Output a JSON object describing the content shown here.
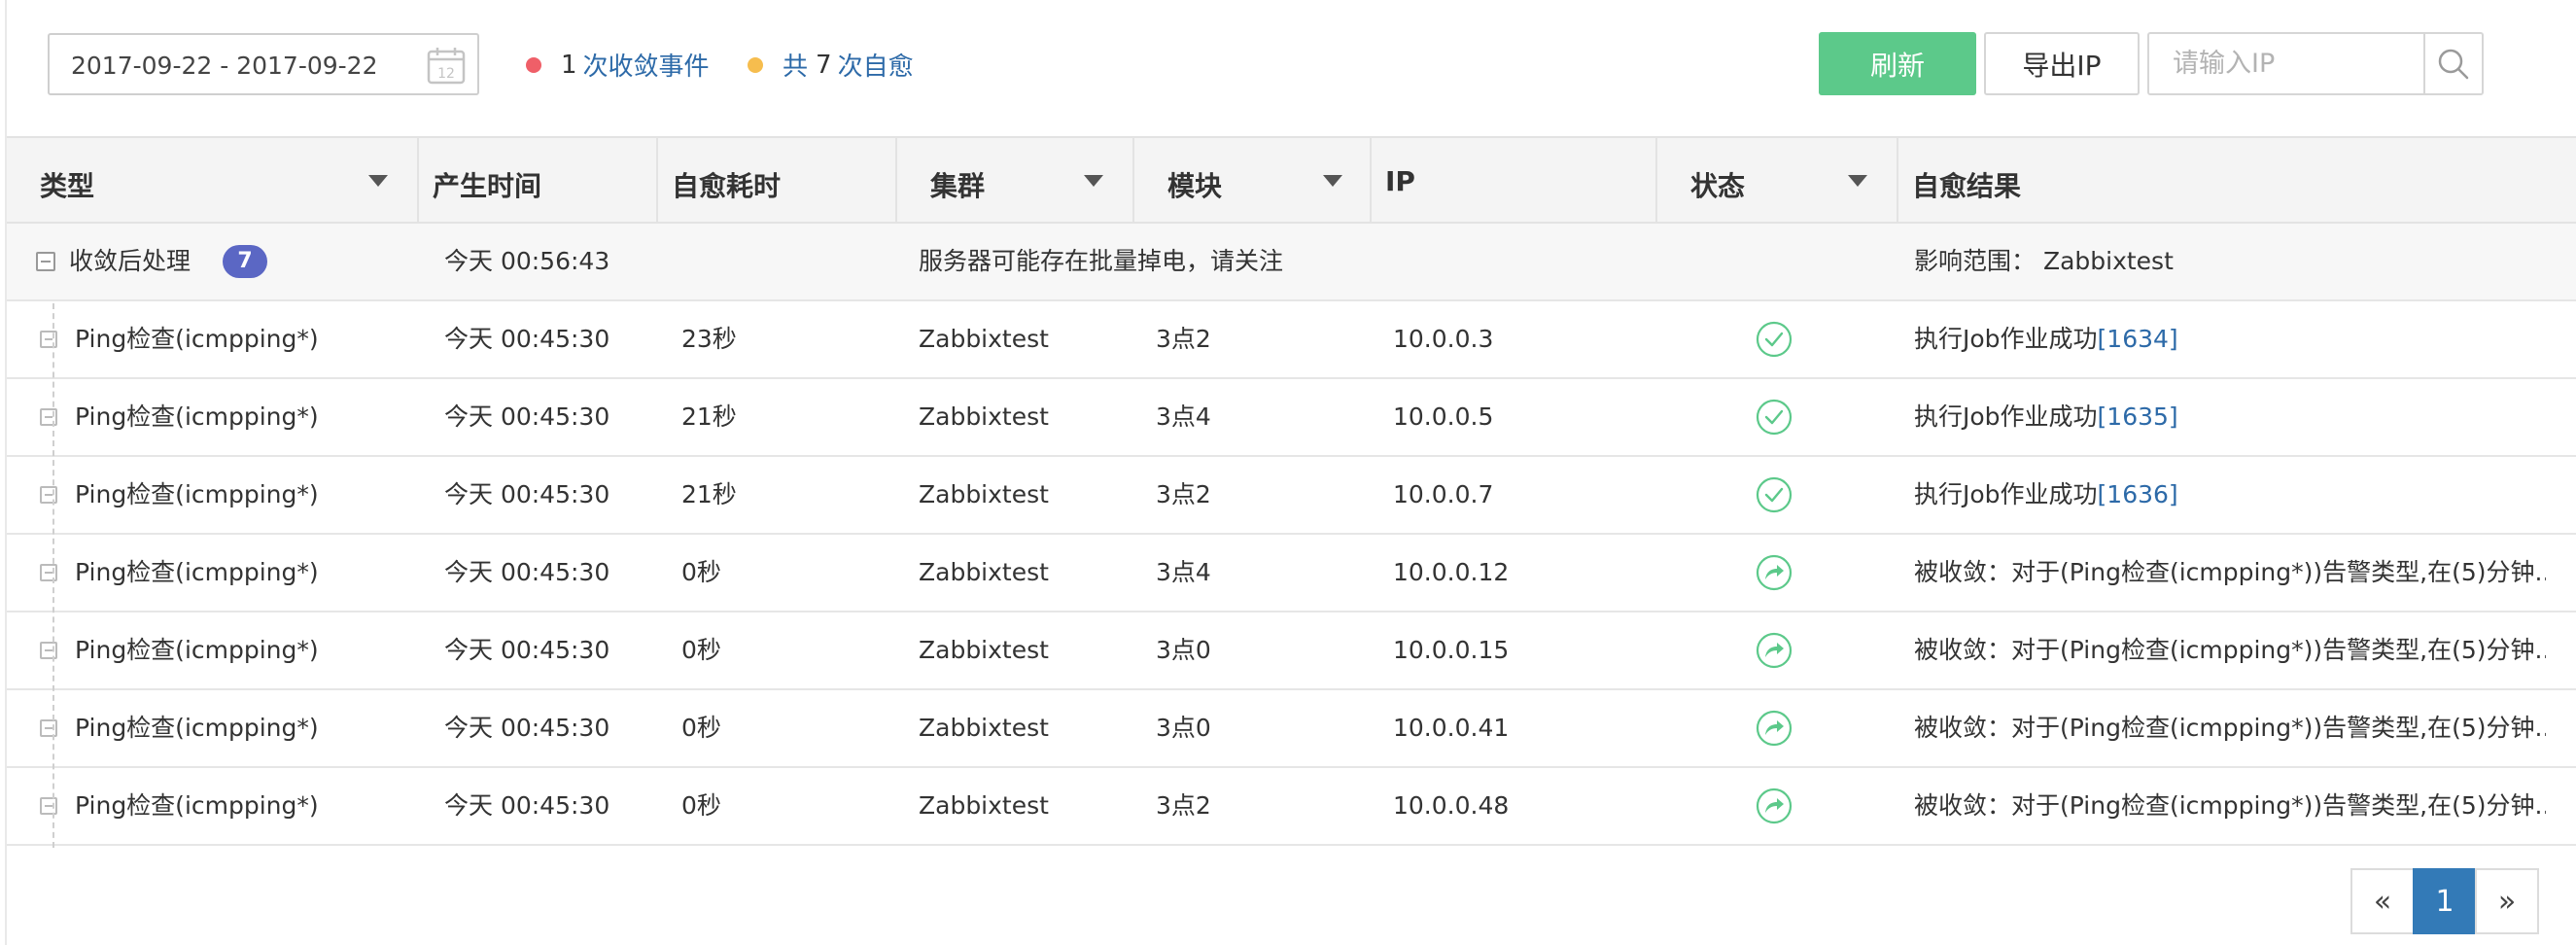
{
  "toolbar": {
    "date_range": "2017-09-22 - 2017-09-22",
    "calendar_day": "12",
    "converge_count": "1",
    "converge_label": "次收敛事件",
    "heal_prefix": "共",
    "heal_count": "7",
    "heal_label": "次自愈",
    "converge_dot_color": "#ef5f68",
    "heal_dot_color": "#f6bd4e",
    "refresh_label": "刷新",
    "export_label": "导出IP",
    "search_placeholder": "请输入IP",
    "search_icon": "search-icon"
  },
  "table": {
    "columns": [
      "类型",
      "产生时间",
      "自愈耗时",
      "集群",
      "模块",
      "IP",
      "状态",
      "自愈结果"
    ],
    "group": {
      "type": "收敛后处理",
      "count": "7",
      "time": "今天 00:56:43",
      "message": "服务器可能存在批量掉电，请关注",
      "scope": "影响范围： Zabbixtest"
    },
    "rows": [
      {
        "type": "Ping检查(icmpping*)",
        "time": "今天 00:45:30",
        "duration": "23秒",
        "cluster": "Zabbixtest",
        "module": "3点2",
        "ip": "10.0.0.3",
        "status": "success",
        "result": "执行Job作业成功",
        "job": "[1634]"
      },
      {
        "type": "Ping检查(icmpping*)",
        "time": "今天 00:45:30",
        "duration": "21秒",
        "cluster": "Zabbixtest",
        "module": "3点4",
        "ip": "10.0.0.5",
        "status": "success",
        "result": "执行Job作业成功",
        "job": "[1635]"
      },
      {
        "type": "Ping检查(icmpping*)",
        "time": "今天 00:45:30",
        "duration": "21秒",
        "cluster": "Zabbixtest",
        "module": "3点2",
        "ip": "10.0.0.7",
        "status": "success",
        "result": "执行Job作业成功",
        "job": "[1636]"
      },
      {
        "type": "Ping检查(icmpping*)",
        "time": "今天 00:45:30",
        "duration": "0秒",
        "cluster": "Zabbixtest",
        "module": "3点4",
        "ip": "10.0.0.12",
        "status": "converged",
        "result": "被收敛：对于(Ping检查(icmpping*))告警类型,在(5)分钟...",
        "job": ""
      },
      {
        "type": "Ping检查(icmpping*)",
        "time": "今天 00:45:30",
        "duration": "0秒",
        "cluster": "Zabbixtest",
        "module": "3点0",
        "ip": "10.0.0.15",
        "status": "converged",
        "result": "被收敛：对于(Ping检查(icmpping*))告警类型,在(5)分钟...",
        "job": ""
      },
      {
        "type": "Ping检查(icmpping*)",
        "time": "今天 00:45:30",
        "duration": "0秒",
        "cluster": "Zabbixtest",
        "module": "3点0",
        "ip": "10.0.0.41",
        "status": "converged",
        "result": "被收敛：对于(Ping检查(icmpping*))告警类型,在(5)分钟...",
        "job": ""
      },
      {
        "type": "Ping检查(icmpping*)",
        "time": "今天 00:45:30",
        "duration": "0秒",
        "cluster": "Zabbixtest",
        "module": "3点2",
        "ip": "10.0.0.48",
        "status": "converged",
        "result": "被收敛：对于(Ping检查(icmpping*))告警类型,在(5)分钟...",
        "job": ""
      }
    ]
  },
  "pagination": {
    "prev": "«",
    "current": "1",
    "next": "»"
  },
  "colors": {
    "accent_green": "#5cc98a",
    "link_blue": "#2d6aa8",
    "badge": "#5b67c4",
    "page_active": "#337ab7",
    "status_icon": "#5cc98a"
  }
}
